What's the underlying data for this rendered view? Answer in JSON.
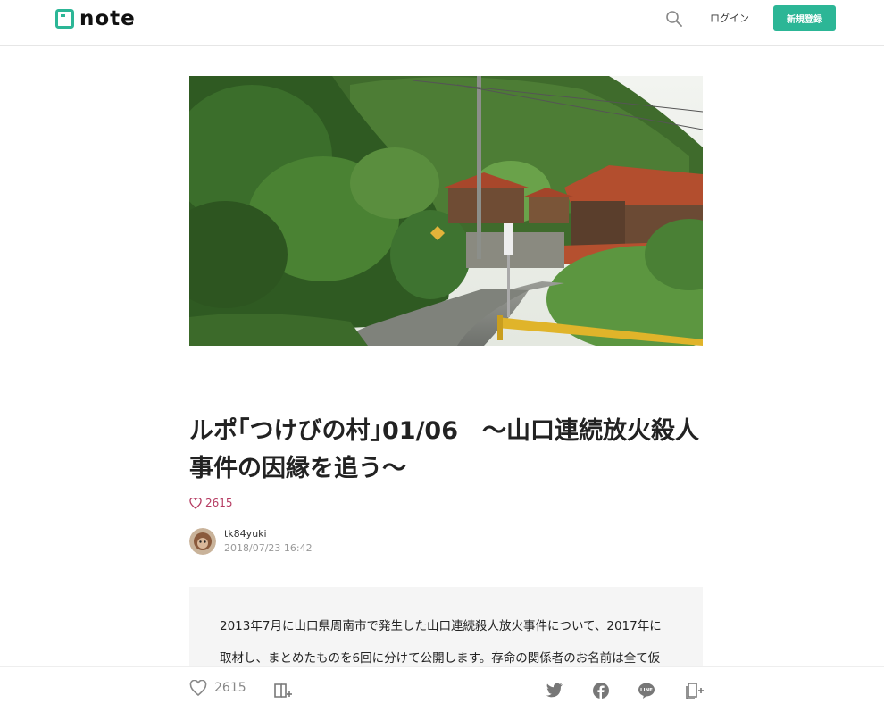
{
  "header": {
    "logo_text": "note",
    "login_label": "ログイン",
    "signup_label": "新規登録",
    "brand_color": "#2cb696"
  },
  "article": {
    "hero_image": "mountain-village-road-photo",
    "title": "ルポ｢つけびの村｣01/06　〜山口連続放火殺人事件の因縁を追う〜",
    "like_count": "2615",
    "author": {
      "name": "tk84yuki",
      "date": "2018/07/23 16:42"
    },
    "summary_lines": [
      "2013年7月に山口県周南市で発生した山口連続殺人放火事件について、2017年に",
      "取材し、まとめたものを6回に分けて公開します。存命の関係者のお名前は全て仮"
    ]
  },
  "action_bar": {
    "like_count": "2615",
    "icons": [
      "heart-icon",
      "magazine-add-icon",
      "twitter-icon",
      "facebook-icon",
      "line-icon",
      "embed-icon"
    ]
  }
}
